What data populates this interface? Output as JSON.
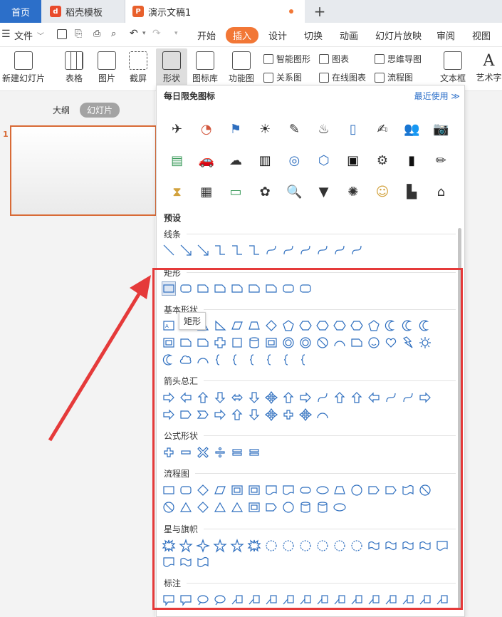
{
  "tabs": {
    "home": "首页",
    "template": "稻壳模板",
    "document": "演示文稿1",
    "new_tab": "+"
  },
  "menu": {
    "file": "文件",
    "items": [
      "开始",
      "插入",
      "设计",
      "切换",
      "动画",
      "幻灯片放映",
      "审阅",
      "视图"
    ],
    "active": "插入"
  },
  "ribbon": {
    "new_slide": "新建幻灯片",
    "table": "表格",
    "picture": "图片",
    "screenshot": "截屏",
    "shape": "形状",
    "icon_lib": "图标库",
    "func_chart": "功能图",
    "smart_shape": "智能图形",
    "chart": "图表",
    "mindmap": "思维导图",
    "relation": "关系图",
    "online_chart": "在线图表",
    "flowchart": "流程图",
    "textbox": "文本框",
    "wordart": "艺术字"
  },
  "leftpanel": {
    "outline": "大纲",
    "slides": "幻灯片",
    "slide_number": "1"
  },
  "panel": {
    "daily_icons": "每日限免图标",
    "recent": "最近使用 ≫",
    "preset": "预设",
    "sections": {
      "lines": "线条",
      "rect": "矩形",
      "basic": "基本形状",
      "arrows": "箭头总汇",
      "formula": "公式形状",
      "flow": "流程图",
      "stars": "星与旗帜",
      "callouts": "标注"
    }
  },
  "tooltip": "矩形",
  "colors": {
    "accent": "#f27736",
    "brand": "#2c6fc9",
    "annotation": "#e53a3a",
    "shape_stroke": "#2f6fbf"
  },
  "icons": [
    "drone-icon",
    "pie-chart-icon",
    "flag-icon",
    "bulb-icon",
    "pen-icon",
    "lamp-icon",
    "book-icon",
    "document-edit-icon",
    "users-icon",
    "camera-icon",
    "wallet-icon",
    "car-icon",
    "weather-icon",
    "building-icon",
    "target-icon",
    "hexagon-icon",
    "contact-icon",
    "gear-icon",
    "bag-icon",
    "note-icon",
    "hourglass-icon",
    "sale-sign-icon",
    "presentation-icon",
    "tree-icon",
    "search-doc-icon",
    "basket-icon",
    "crab-icon",
    "worker-icon",
    "factory-icon",
    "home-icon"
  ]
}
